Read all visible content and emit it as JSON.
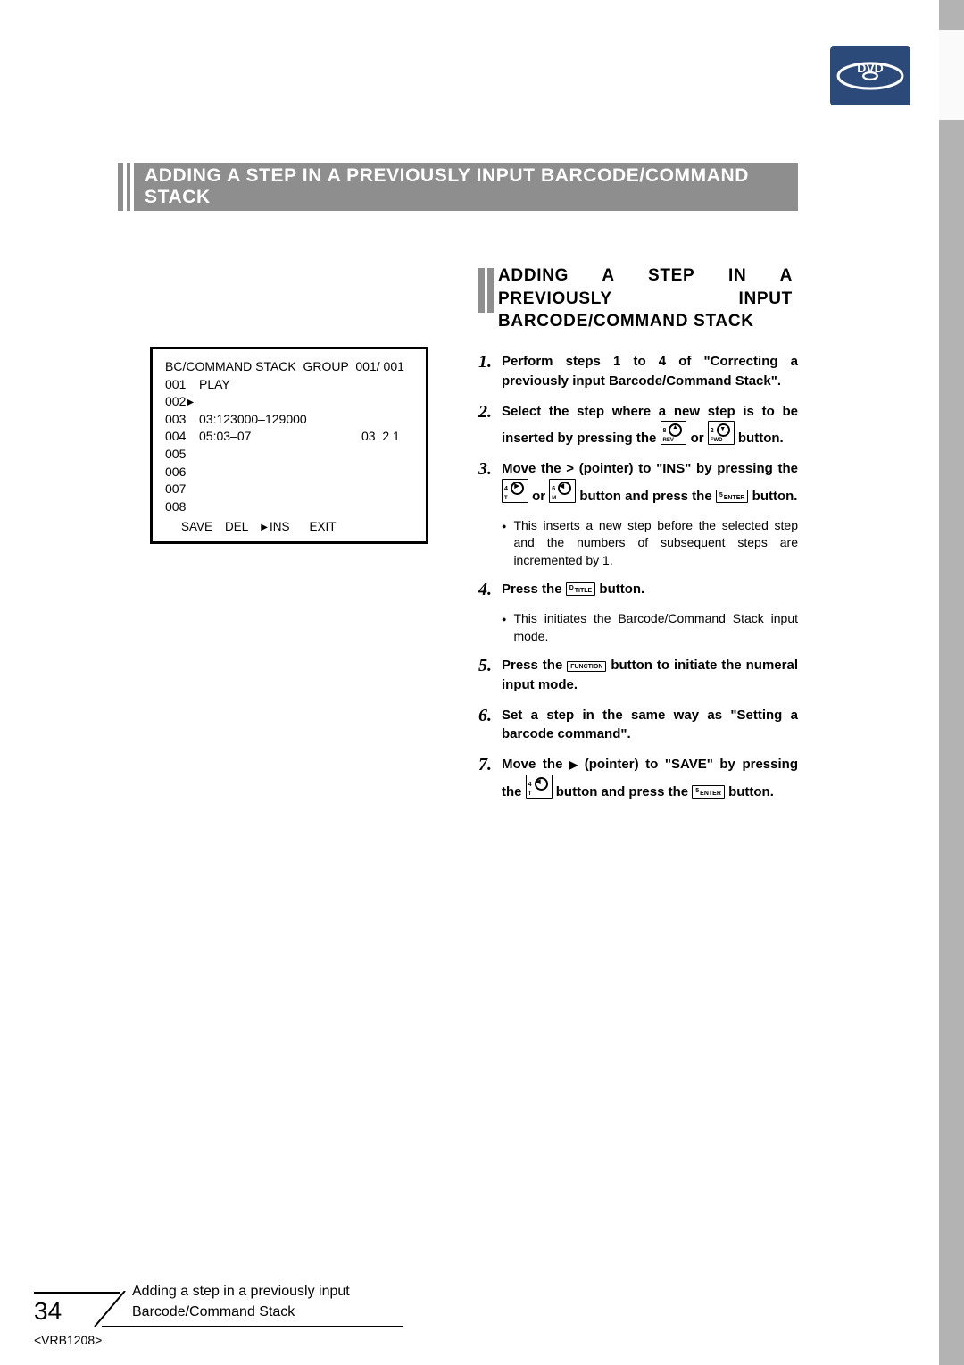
{
  "logo": {
    "text": "DVD"
  },
  "banner": {
    "title": "ADDING A STEP IN A PREVIOUSLY INPUT BARCODE/COMMAND STACK"
  },
  "subheading": {
    "text": "ADDING A STEP IN A PREVIOUSLY INPUT BARCODE/COMMAND STACK"
  },
  "screen": {
    "header": "BC/COMMAND STACK  GROUP  001/ 001",
    "rows": [
      {
        "n": "001",
        "c2": "PLAY",
        "c3": ""
      },
      {
        "n": "002",
        "c2": "",
        "c3": "",
        "hasTri": true
      },
      {
        "n": "003",
        "c2": "03:123000–129000",
        "c3": ""
      },
      {
        "n": "004",
        "c2": "05:03–07",
        "c3": "03  2 1"
      },
      {
        "n": "005",
        "c2": "",
        "c3": ""
      },
      {
        "n": "006",
        "c2": "",
        "c3": ""
      },
      {
        "n": "007",
        "c2": "",
        "c3": ""
      },
      {
        "n": "008",
        "c2": "",
        "c3": ""
      }
    ],
    "footer": {
      "save": "SAVE",
      "del": "DEL",
      "ins": "INS",
      "exit": "EXIT"
    }
  },
  "steps": {
    "s1": {
      "text_a": "Perform steps 1 to 4 of \"Correcting a previously input Barcode/Command Stack\"."
    },
    "s2": {
      "text_a": "Select the step where a new step is to be inserted by pressing the ",
      "or": " or ",
      "text_b": " button."
    },
    "s3": {
      "text_a": "Move the > (pointer) to \"INS\" by pressing the ",
      "or": " or ",
      "text_b": " button and press the ",
      "text_c": " button.",
      "note": "This inserts a new step before the selected step and the numbers of subsequent steps are incremented by 1."
    },
    "s4": {
      "text_a": "Press the ",
      "text_b": " button.",
      "note": "This initiates the Barcode/Command Stack input mode."
    },
    "s5": {
      "text_a": "Press the ",
      "text_b": " button to initiate the numeral input mode."
    },
    "s6": {
      "text_a": "Set a step in the same way as \"Setting a barcode command\"."
    },
    "s7": {
      "text_a": "Move the ",
      "text_b": " (pointer) to \"SAVE\" by pressing the ",
      "text_c": " button and press the ",
      "text_d": " button."
    }
  },
  "keys": {
    "up_rev": {
      "label": "8",
      "sub": "REV"
    },
    "down_fwd": {
      "label": "2",
      "sub": "FWD"
    },
    "right_t": {
      "label": "4",
      "sub": "T"
    },
    "left_menu": {
      "label": "6",
      "sub": "M"
    },
    "enter": "ENTER",
    "title": "TITLE",
    "title_sub": "D",
    "function": "FUNCTION",
    "enter_sub": "5"
  },
  "nums": {
    "1": "1.",
    "2": "2.",
    "3": "3.",
    "4": "4.",
    "5": "5.",
    "6": "6.",
    "7": "7."
  },
  "footer": {
    "page": "34",
    "section": "Adding a step in a previously input Barcode/Command Stack",
    "docid": "<VRB1208>"
  }
}
